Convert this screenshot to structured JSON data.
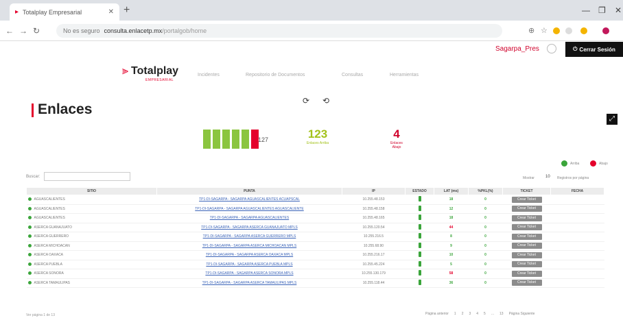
{
  "browser": {
    "tab_title": "Totalplay Empresarial",
    "address_secure": "No es seguro",
    "address_host": "consulta.enlacetp.mx",
    "address_path": "/portalgob/home"
  },
  "header": {
    "user_name": "Sagarpa_Pres",
    "logout_label": "Cerrar Sesión"
  },
  "brand": {
    "name": "Totalplay",
    "sub": "EMPRESARIAL"
  },
  "nav": {
    "items": [
      "Incidentes",
      "Repositorio de Documentos",
      "Consultas",
      "Herramientas"
    ]
  },
  "page": {
    "title": "Enlaces"
  },
  "summary": {
    "total": "127",
    "up": {
      "value": "123",
      "label": "Enlaces Arriba"
    },
    "down": {
      "value": "4",
      "label": "Enlaces Abajo"
    },
    "gauge_up_fraction": 0.97
  },
  "legend": {
    "up": "Arriba",
    "down": "Abajo"
  },
  "table_controls": {
    "search_label": "Buscar:",
    "show_label": "Mostrar",
    "show_value": "10",
    "per_page_label": "Registros por página"
  },
  "table": {
    "headers": [
      "SITIO",
      "PUNTA",
      "IP",
      "ESTADO",
      "LAT (ms)",
      "%PKL(%)",
      "TICKET",
      "FECHA"
    ],
    "rows": [
      {
        "sitio": "AGUASCALIENTES",
        "punta": "TP1-DI-SAGARPA - SAGARPA AGUASCALIENTES ACUAPSCAL",
        "ip": "10.255.48.153",
        "lat": "18",
        "lat_color": "#3ba53b",
        "pkt": "0",
        "ticket": "Crear Ticket"
      },
      {
        "sitio": "AGUASCALIENTES",
        "punta": "TP1-DI-SAGARPA - SAGARPA AGUASCALIENTES AGUASCALIENTE",
        "ip": "10.255.48.158",
        "lat": "12",
        "lat_color": "#3ba53b",
        "pkt": "0",
        "ticket": "Crear Ticket"
      },
      {
        "sitio": "AGUASCALIENTES",
        "punta": "TP1-DI-SAGARPA - SAGARPA AGUASCALIENTES",
        "ip": "10.255.48.165",
        "lat": "18",
        "lat_color": "#3ba53b",
        "pkt": "0",
        "ticket": "Crear Ticket"
      },
      {
        "sitio": "ASERCA GUANAJUATO",
        "punta": "TP1-DI-SAGARPA - SAGARPA ASERCA GUANAJUATO MPLS",
        "ip": "10.255.120.54",
        "lat": "44",
        "lat_color": "#e4002b",
        "pkt": "0",
        "ticket": "Crear Ticket"
      },
      {
        "sitio": "ASERCA GUERRERO",
        "punta": "TP1-DI-SAGARPA - SAGARPA ASERCA GUERRERO MPLS",
        "ip": "10.255.216.5",
        "lat": "8",
        "lat_color": "#3ba53b",
        "pkt": "0",
        "ticket": "Crear Ticket"
      },
      {
        "sitio": "ASERCA MICHOACAN",
        "punta": "TP1-DI-SAGARPA - SAGARPA ASERCA MICHOACAN MPLS",
        "ip": "10.255.68.90",
        "lat": "9",
        "lat_color": "#3ba53b",
        "pkt": "0",
        "ticket": "Crear Ticket"
      },
      {
        "sitio": "ASERCA OAXACA",
        "punta": "TP1-DI-SAGARPA - SAGARPA ASERCA OAXACA MPLS",
        "ip": "10.255.216.17",
        "lat": "10",
        "lat_color": "#3ba53b",
        "pkt": "0",
        "ticket": "Crear Ticket"
      },
      {
        "sitio": "ASERCA PUEBLA",
        "punta": "TP1-DI-SAGARPA - SAGARPA ASERCA PUEBLA MPLS",
        "ip": "10.255.45.224",
        "lat": "5",
        "lat_color": "#3ba53b",
        "pkt": "0",
        "ticket": "Crear Ticket"
      },
      {
        "sitio": "ASERCA SONORA",
        "punta": "TP1-DI-SAGARPA - SAGARPA ASERCA SONORA MPLS",
        "ip": "10.255.130.179",
        "lat": "58",
        "lat_color": "#e4002b",
        "pkt": "0",
        "ticket": "Crear Ticket"
      },
      {
        "sitio": "ASERCA TAMAULIPAS",
        "punta": "TP1-DI-SAGARPA - SAGARPA ASERCA TAMAULIPAS MPLS",
        "ip": "10.255.118.44",
        "lat": "36",
        "lat_color": "#3ba53b",
        "pkt": "0",
        "ticket": "Crear Ticket"
      }
    ]
  },
  "footer": {
    "info": "Ver página 1 de 13",
    "prev": "Página anterior",
    "pages": [
      "1",
      "2",
      "3",
      "4",
      "5",
      "...",
      "13"
    ],
    "next": "Página Siguiente"
  },
  "colors": {
    "brand_red": "#e4002b",
    "up_green": "#3ba53b",
    "gauge_green": "#8bc53f",
    "stat_up": "#a3c21b",
    "stat_down": "#d0022b"
  }
}
